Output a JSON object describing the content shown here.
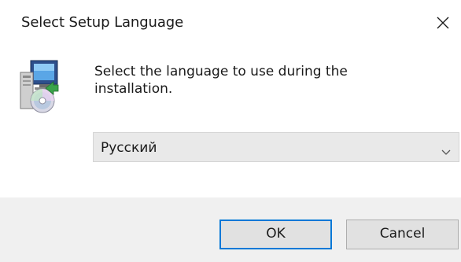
{
  "dialog": {
    "title": "Select Setup Language",
    "close_icon": "close-icon"
  },
  "content": {
    "icon": "setup-computer-cd-icon",
    "prompt": "Select the language to use during the installation."
  },
  "language_select": {
    "selected": "Русский",
    "icon": "chevron-down-icon"
  },
  "buttons": {
    "ok_label": "OK",
    "cancel_label": "Cancel"
  },
  "colors": {
    "ok_focus_border": "#0078d7",
    "footer_bg": "#f0f0f0",
    "select_bg": "#e9e9e9"
  }
}
